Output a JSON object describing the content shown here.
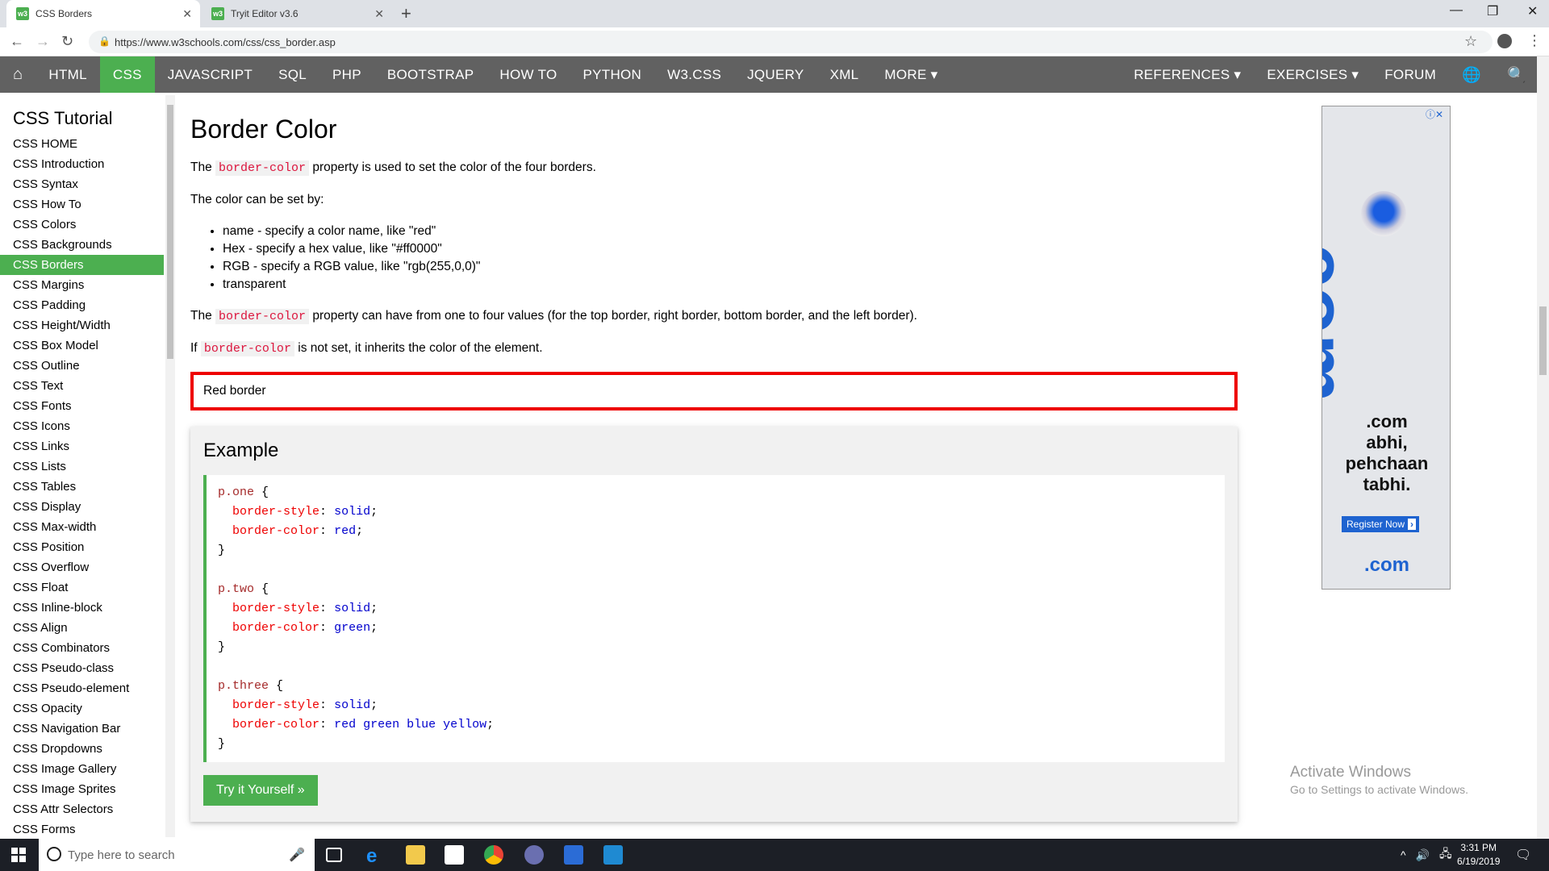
{
  "browser": {
    "tabs": [
      {
        "title": "CSS Borders",
        "favicon": "w3"
      },
      {
        "title": "Tryit Editor v3.6",
        "favicon": "w3"
      }
    ],
    "url": "https://www.w3schools.com/css/css_border.asp"
  },
  "topnav": {
    "left": [
      "HTML",
      "CSS",
      "JAVASCRIPT",
      "SQL",
      "PHP",
      "BOOTSTRAP",
      "HOW TO",
      "PYTHON",
      "W3.CSS",
      "JQUERY",
      "XML",
      "MORE ▾"
    ],
    "active": "CSS",
    "right": [
      "REFERENCES ▾",
      "EXERCISES ▾",
      "FORUM"
    ]
  },
  "sidebar": {
    "title": "CSS Tutorial",
    "items": [
      "CSS HOME",
      "CSS Introduction",
      "CSS Syntax",
      "CSS How To",
      "CSS Colors",
      "CSS Backgrounds",
      "CSS Borders",
      "CSS Margins",
      "CSS Padding",
      "CSS Height/Width",
      "CSS Box Model",
      "CSS Outline",
      "CSS Text",
      "CSS Fonts",
      "CSS Icons",
      "CSS Links",
      "CSS Lists",
      "CSS Tables",
      "CSS Display",
      "CSS Max-width",
      "CSS Position",
      "CSS Overflow",
      "CSS Float",
      "CSS Inline-block",
      "CSS Align",
      "CSS Combinators",
      "CSS Pseudo-class",
      "CSS Pseudo-element",
      "CSS Opacity",
      "CSS Navigation Bar",
      "CSS Dropdowns",
      "CSS Image Gallery",
      "CSS Image Sprites",
      "CSS Attr Selectors",
      "CSS Forms"
    ],
    "active": "CSS Borders"
  },
  "main": {
    "heading": "Border Color",
    "p1_before": "The ",
    "p1_code": "border-color",
    "p1_after": " property is used to set the color of the four borders.",
    "p2": "The color can be set by:",
    "list": [
      "name - specify a color name, like \"red\"",
      "Hex - specify a hex value, like \"#ff0000\"",
      "RGB - specify a RGB value, like \"rgb(255,0,0)\"",
      "transparent"
    ],
    "p3_before": "The ",
    "p3_code": "border-color",
    "p3_after": " property can have from one to four values (for the top border, right border, bottom border, and the left border).",
    "p4_before": "If ",
    "p4_code": "border-color",
    "p4_after": " is not set, it inherits the color of the element.",
    "redbox": "Red border",
    "example_title": "Example",
    "code": {
      "b1_sel": "p.one",
      "b1_v1": "solid",
      "b1_v2": "red",
      "b2_sel": "p.two",
      "b2_v1": "solid",
      "b2_v2": "green",
      "b3_sel": "p.three",
      "b3_v1": "solid",
      "b3_v2": "red green blue yellow",
      "prop_style": "border-style",
      "prop_color": "border-color",
      "open": " {",
      "close": "}"
    },
    "tryit": "Try it Yourself »"
  },
  "ad": {
    "big": "com",
    "tagline_1": ".com",
    "tagline_2": "abhi,",
    "tagline_3": "pehchaan",
    "tagline_4": "tabhi.",
    "register": "Register Now",
    "logo": ".com"
  },
  "watermark": {
    "line1": "Activate Windows",
    "line2": "Go to Settings to activate Windows."
  },
  "taskbar": {
    "search_placeholder": "Type here to search",
    "time": "3:31 PM",
    "date": "6/19/2019"
  },
  "colors": {
    "w3_green": "#4CAF50",
    "topnav_bg": "#616161",
    "red_border": "#ee0000"
  }
}
